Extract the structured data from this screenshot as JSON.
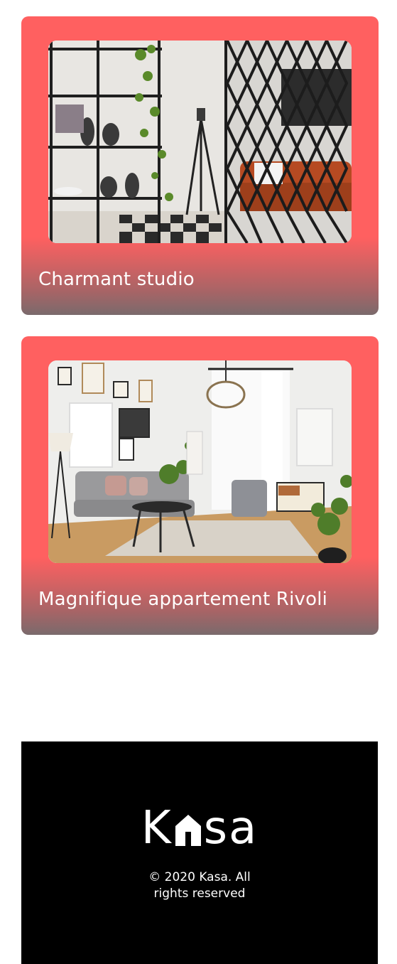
{
  "listings": [
    {
      "title": "Charmant studio",
      "image_alt": "studio"
    },
    {
      "title": "Magnifique appartement Rivoli",
      "image_alt": "appartement"
    }
  ],
  "footer": {
    "logo_left": "K",
    "logo_right": "sa",
    "logo_icon": "house-icon",
    "copyright_line1": "© 2020 Kasa. All",
    "copyright_line2": "rights reserved"
  },
  "colors": {
    "card_background": "#ff6060",
    "footer_background": "#000000",
    "text_light": "#ffffff"
  }
}
